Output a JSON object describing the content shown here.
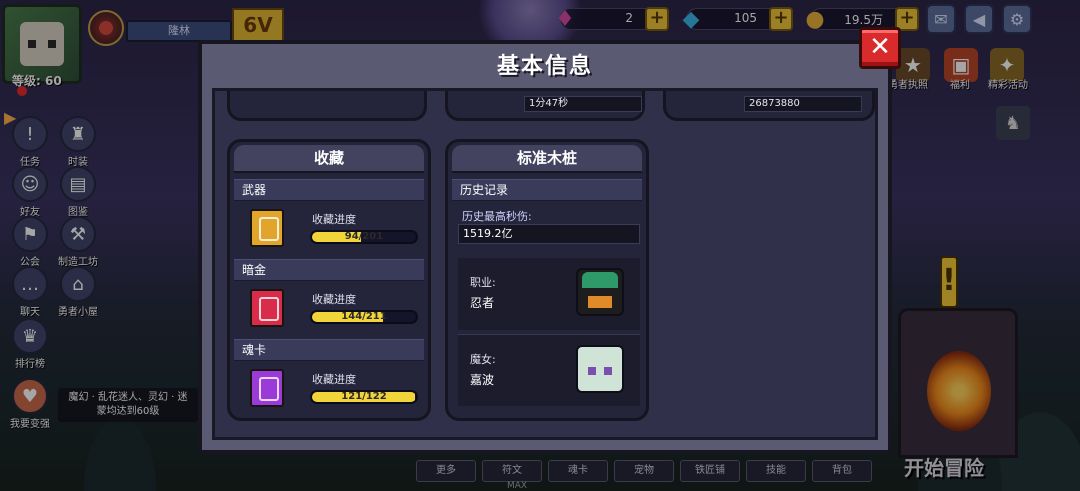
{
  "player": {
    "name": "隆林",
    "level": "等级: 60",
    "vip": "6V"
  },
  "resources": [
    {
      "icon": "heart-gem-icon",
      "value": "2",
      "color": "#d64aa0"
    },
    {
      "icon": "diamond-icon",
      "value": "105",
      "color": "#3ab6e8"
    },
    {
      "icon": "gold-coin-icon",
      "value": "19.5万",
      "color": "#e8b23a"
    }
  ],
  "events": [
    {
      "label": "勇者执照",
      "icon": "license-icon"
    },
    {
      "label": "福利",
      "icon": "gift-icon"
    },
    {
      "label": "精彩活动",
      "icon": "events-icon"
    }
  ],
  "side_menu": [
    {
      "label": "任务",
      "icon": "quest-icon"
    },
    {
      "label": "时装",
      "icon": "costume-icon"
    },
    {
      "label": "好友",
      "icon": "friends-icon"
    },
    {
      "label": "图鉴",
      "icon": "codex-icon"
    },
    {
      "label": "公会",
      "icon": "guild-icon"
    },
    {
      "label": "制造工坊",
      "icon": "workshop-icon"
    },
    {
      "label": "聊天",
      "icon": "chat-icon"
    },
    {
      "label": "勇者小屋",
      "icon": "cabin-icon"
    },
    {
      "label": "排行榜",
      "icon": "ranking-icon"
    },
    {
      "label": "我要变强",
      "icon": "power-up-icon"
    }
  ],
  "notice": "魔幻 · 乱花迷人、灵幻 · 迷蒙均达到60级",
  "bottom_tabs": [
    "更多",
    "符文",
    "魂卡",
    "宠物",
    "铁匠铺",
    "技能",
    "背包"
  ],
  "max_label": "MAX",
  "start_label": "开始冒险",
  "modal": {
    "title": "基本信息",
    "close": "✕",
    "top_values": [
      "1分47秒",
      "26873880"
    ],
    "collection": {
      "title": "收藏",
      "progress_label": "收藏进度",
      "items": [
        {
          "category": "武器",
          "progress": "94/201",
          "fraction": 0.4677,
          "color": "#e0a52a"
        },
        {
          "category": "暗金",
          "progress": "144/211",
          "fraction": 0.6825,
          "color": "#d92b4a"
        },
        {
          "category": "魂卡",
          "progress": "121/122",
          "fraction": 0.9918,
          "color": "#9a3ad9"
        }
      ]
    },
    "dummy": {
      "title": "标准木桩",
      "history_title": "历史记录",
      "max_dps_label": "历史最高秒伤:",
      "max_dps_value": "1519.2亿",
      "class_label": "职业:",
      "class_value": "忍者",
      "witch_label": "魔女:",
      "witch_value": "嘉波"
    }
  }
}
